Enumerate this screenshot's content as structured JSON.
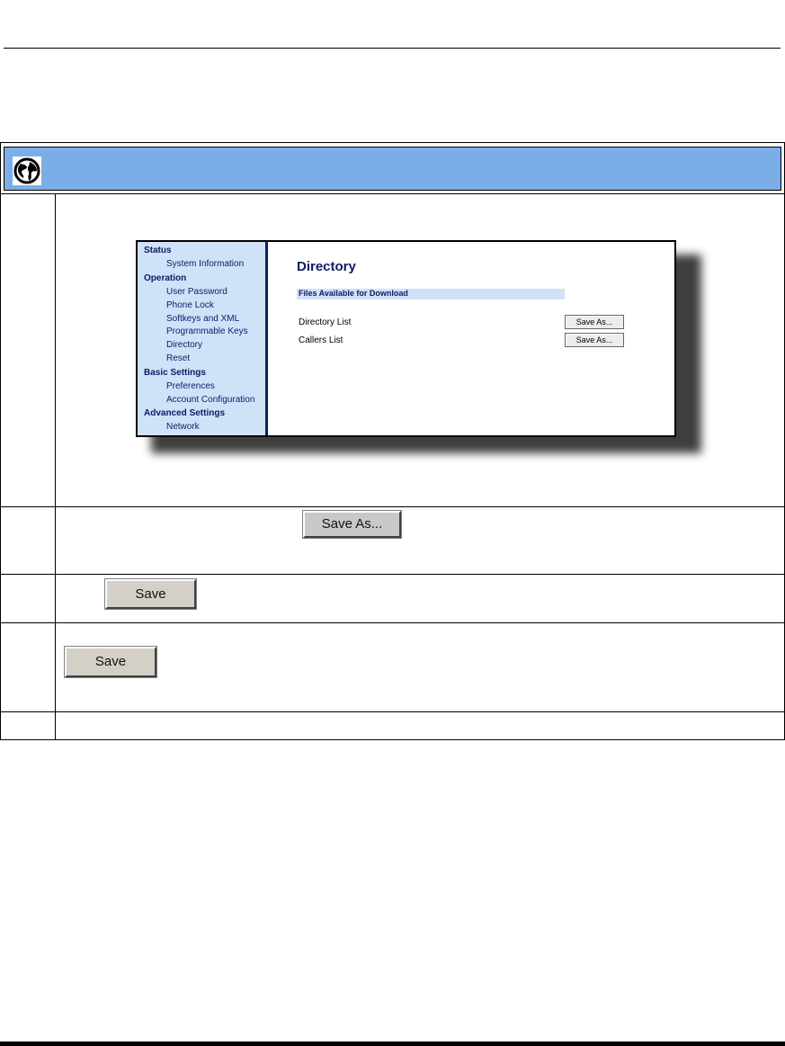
{
  "web_ui": {
    "nav": {
      "groups": [
        {
          "label": "Status",
          "items": [
            "System Information"
          ]
        },
        {
          "label": "Operation",
          "items": [
            "User Password",
            "Phone Lock",
            "Softkeys and XML",
            "Programmable Keys",
            "Directory",
            "Reset"
          ]
        },
        {
          "label": "Basic Settings",
          "items": [
            "Preferences",
            "Account Configuration"
          ]
        },
        {
          "label": "Advanced Settings",
          "items": [
            "Network"
          ]
        }
      ]
    },
    "page_title": "Directory",
    "section_header": "Files Available for Download",
    "files": [
      {
        "label": "Directory List",
        "button": "Save As..."
      },
      {
        "label": "Callers List",
        "button": "Save As..."
      }
    ]
  },
  "buttons": {
    "save_as": "Save As...",
    "save_1": "Save",
    "save_2": "Save"
  },
  "icons": {
    "banner": "globe-icon"
  },
  "colors": {
    "banner": "#7baee6",
    "nav_bg": "#cfe2f8",
    "nav_text": "#0b1d66"
  }
}
